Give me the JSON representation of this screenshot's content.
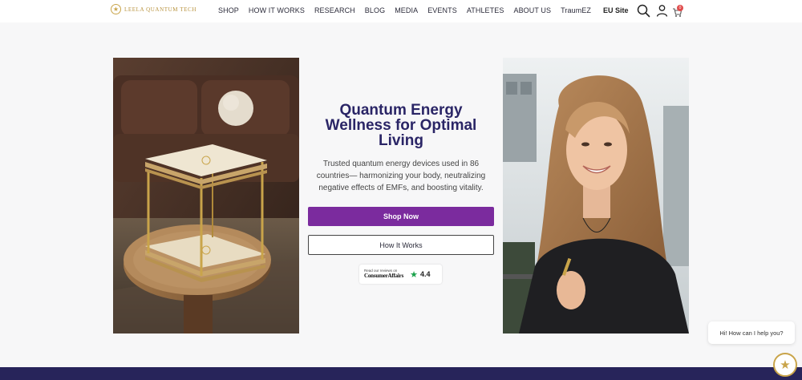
{
  "header": {
    "logo_text": "LEELA QUANTUM TECH",
    "nav": [
      "SHOP",
      "HOW IT WORKS",
      "RESEARCH",
      "BLOG",
      "MEDIA",
      "EVENTS",
      "ATHLETES",
      "ABOUT US",
      "TraumEZ"
    ],
    "eu_site": "EU Site",
    "cart_count": "0",
    "icons": [
      "search-icon",
      "user-icon",
      "cart-icon"
    ]
  },
  "hero": {
    "headline": "Quantum Energy Wellness for Optimal Living",
    "subtext": "Trusted quantum energy devices used in 86 countries— harmonizing your body, neutralizing negative effects of EMFs, and boosting vitality.",
    "primary_button": "Shop Now",
    "secondary_button": "How It Works",
    "review": {
      "small_text": "Read our reviews on",
      "brand": "ConsumerAffairs",
      "score": "4.4"
    }
  },
  "chat": {
    "bubble_text": "Hi! How can I help you?"
  },
  "colors": {
    "primary": "#7b2b9e",
    "headline": "#2a2566",
    "footer": "#27245a",
    "gold": "#c9a44a"
  }
}
